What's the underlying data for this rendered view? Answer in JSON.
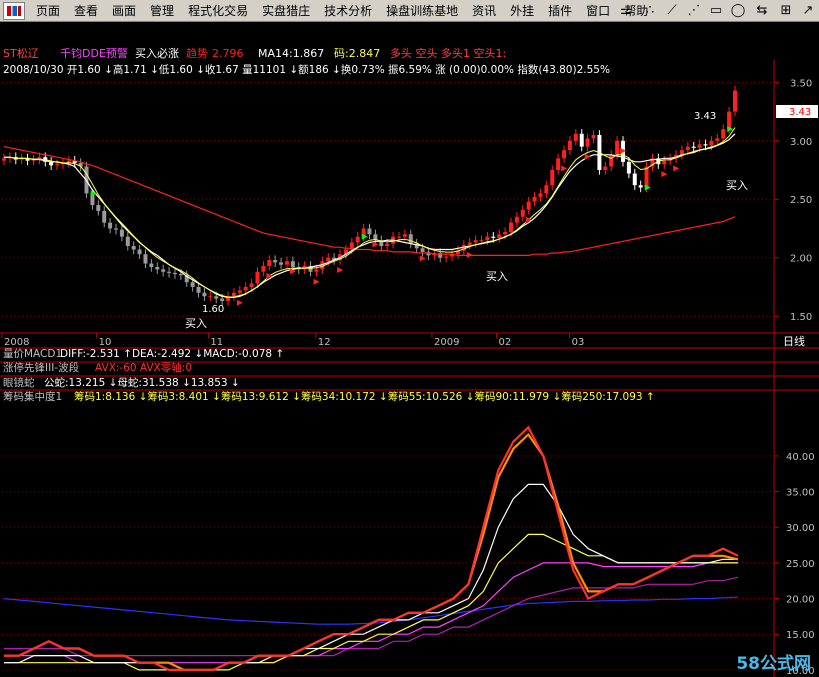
{
  "menubar": {
    "items": [
      "页面",
      "查看",
      "画面",
      "管理",
      "程式化交易",
      "实盘猎庄",
      "技术分析",
      "操盘训练基地",
      "资讯",
      "外挂",
      "插件",
      "窗口",
      "帮助"
    ]
  },
  "toolbar": {
    "icons": [
      "chart-dash-icon",
      "dots-icon",
      "line-tool-icon",
      "fan-tool-icon",
      "ray-tool-icon",
      "rectangle-icon",
      "ellipse-icon",
      "arrows-icon",
      "grid-icon"
    ]
  },
  "colors": {
    "background": "#000000",
    "up": "#ff2020",
    "down": "#ffffff",
    "grid": "#7a0000",
    "ma_short": "#ffffff",
    "ma_long": "#ff2020",
    "ma_yellow": "#ffff40",
    "blue": "#2020ff",
    "magenta": "#ff20ff",
    "orange": "#ff6000",
    "buy_green": "#00ff00",
    "axis_text": "#c0c0c0"
  },
  "header": {
    "stock": "ST松辽",
    "indicator": "千钧DDE预警",
    "signal": "买入必涨",
    "trend_label": "趋势",
    "trend_value": "2.796",
    "ma14": "MA14:1.867",
    "code_label": "码:2.847",
    "flags": "多头  空头  多头1  空头1:",
    "line2": "2008/10/30  开1.60 ↓高1.71 ↓低1.60 ↓收1.67  量11101 ↓额186 ↓换0.73%  振6.59%  涨 (0.00)0.00%  指数(43.80)2.55%"
  },
  "panels": {
    "macd_title": "量价MACD1",
    "macd_values": "DIFF:-2.531 ↑DEA:-2.492 ↓MACD:-0.078 ↑",
    "wave_title": "涨停先锋III-波段",
    "wave_values": "AVX:-60  AVX零轴:0",
    "snake_title": "眼镜蛇",
    "snake_values": "公蛇:13.215 ↓母蛇:31.538 ↓13.853 ↓",
    "chip_title": "筹码集中度1",
    "chip_values": "筹码1:8.136 ↓筹码3:8.401 ↓筹码13:9.612 ↓筹码34:10.172 ↓筹码55:10.526 ↓筹码90:11.979 ↓筹码250:17.093 ↑"
  },
  "annotations": {
    "buy": "买入",
    "low_label": "1.60",
    "high_label": "3.43",
    "current_price": "3.43",
    "day_label": "日线",
    "watermark": "58公式网",
    "watermark_url": "www.58gu.com"
  },
  "chart_data": [
    {
      "type": "candlestick",
      "title": "ST松辽 日线",
      "x_labels": [
        "2008",
        "10",
        "11",
        "12",
        "2009",
        "02",
        "03"
      ],
      "y_ticks": [
        1.5,
        2.0,
        2.5,
        3.0,
        3.5
      ],
      "ylim": [
        1.45,
        3.52
      ],
      "close": [
        2.85,
        2.86,
        2.84,
        2.85,
        2.83,
        2.84,
        2.86,
        2.82,
        2.79,
        2.8,
        2.81,
        2.83,
        2.81,
        2.78,
        2.55,
        2.45,
        2.4,
        2.3,
        2.25,
        2.24,
        2.18,
        2.1,
        2.07,
        2.03,
        1.95,
        1.92,
        1.9,
        1.88,
        1.87,
        1.86,
        1.85,
        1.79,
        1.75,
        1.7,
        1.67,
        1.67,
        1.65,
        1.63,
        1.67,
        1.7,
        1.72,
        1.75,
        1.78,
        1.88,
        1.93,
        1.98,
        1.96,
        1.94,
        1.97,
        1.92,
        1.9,
        1.93,
        1.88,
        1.9,
        1.97,
        2.0,
        1.98,
        2.03,
        2.07,
        2.13,
        2.18,
        2.25,
        2.2,
        2.15,
        2.1,
        2.12,
        2.18,
        2.18,
        2.2,
        2.12,
        2.08,
        2.05,
        2.02,
        2.04,
        2.0,
        2.01,
        2.03,
        2.06,
        2.11,
        2.13,
        2.15,
        2.15,
        2.18,
        2.17,
        2.2,
        2.22,
        2.3,
        2.35,
        2.41,
        2.48,
        2.52,
        2.55,
        2.62,
        2.75,
        2.85,
        2.92,
        3.0,
        3.06,
        2.95,
        3.02,
        3.05,
        2.75,
        2.78,
        2.88,
        3.0,
        2.82,
        2.72,
        2.62,
        2.6,
        2.78,
        2.85,
        2.8,
        2.83,
        2.85,
        2.88,
        2.92,
        2.95,
        2.94,
        2.97,
        2.96,
        3.0,
        3.02,
        3.1,
        3.25,
        3.43
      ],
      "ma_white": [
        2.86,
        2.86,
        2.85,
        2.85,
        2.85,
        2.84,
        2.84,
        2.83,
        2.82,
        2.82,
        2.81,
        2.8,
        2.78,
        2.72,
        2.66,
        2.58,
        2.52,
        2.46,
        2.4,
        2.34,
        2.28,
        2.23,
        2.18,
        2.13,
        2.09,
        2.05,
        2.02,
        1.98,
        1.94,
        1.91,
        1.88,
        1.84,
        1.81,
        1.78,
        1.75,
        1.72,
        1.69,
        1.67,
        1.66,
        1.66,
        1.67,
        1.69,
        1.72,
        1.75,
        1.79,
        1.82,
        1.85,
        1.87,
        1.89,
        1.9,
        1.91,
        1.91,
        1.92,
        1.93,
        1.94,
        1.96,
        1.98,
        2.0,
        2.03,
        2.06,
        2.09,
        2.11,
        2.13,
        2.14,
        2.14,
        2.15,
        2.15,
        2.14,
        2.13,
        2.12,
        2.11,
        2.1,
        2.08,
        2.07,
        2.07,
        2.07,
        2.07,
        2.08,
        2.09,
        2.1,
        2.11,
        2.12,
        2.13,
        2.14,
        2.16,
        2.18,
        2.2,
        2.23,
        2.27,
        2.3,
        2.34,
        2.39,
        2.45,
        2.52,
        2.6,
        2.67,
        2.74,
        2.79,
        2.83,
        2.86,
        2.88,
        2.88,
        2.88,
        2.88,
        2.87,
        2.86,
        2.84,
        2.82,
        2.82,
        2.83,
        2.84,
        2.84,
        2.85,
        2.85,
        2.86,
        2.88,
        2.89,
        2.9,
        2.92,
        2.93,
        2.94,
        2.96,
        2.98,
        3.01,
        3.06
      ],
      "ma_red": [
        2.95,
        2.94,
        2.93,
        2.92,
        2.91,
        2.9,
        2.89,
        2.88,
        2.87,
        2.86,
        2.85,
        2.84,
        2.83,
        2.82,
        2.8,
        2.79,
        2.77,
        2.75,
        2.73,
        2.71,
        2.69,
        2.67,
        2.65,
        2.63,
        2.61,
        2.59,
        2.57,
        2.55,
        2.53,
        2.51,
        2.49,
        2.47,
        2.45,
        2.43,
        2.41,
        2.39,
        2.37,
        2.35,
        2.33,
        2.31,
        2.29,
        2.27,
        2.25,
        2.23,
        2.21,
        2.2,
        2.19,
        2.18,
        2.17,
        2.16,
        2.15,
        2.14,
        2.13,
        2.12,
        2.11,
        2.1,
        2.09,
        2.09,
        2.08,
        2.08,
        2.07,
        2.07,
        2.07,
        2.06,
        2.06,
        2.06,
        2.05,
        2.05,
        2.05,
        2.05,
        2.04,
        2.04,
        2.04,
        2.03,
        2.03,
        2.03,
        2.03,
        2.02,
        2.02,
        2.02,
        2.02,
        2.02,
        2.02,
        2.02,
        2.02,
        2.02,
        2.02,
        2.02,
        2.02,
        2.02,
        2.03,
        2.03,
        2.03,
        2.04,
        2.04,
        2.05,
        2.05,
        2.06,
        2.07,
        2.08,
        2.09,
        2.1,
        2.11,
        2.12,
        2.13,
        2.14,
        2.15,
        2.16,
        2.17,
        2.18,
        2.19,
        2.2,
        2.21,
        2.22,
        2.23,
        2.24,
        2.25,
        2.26,
        2.27,
        2.28,
        2.29,
        2.3,
        2.31,
        2.33,
        2.35
      ]
    },
    {
      "type": "line",
      "title": "筹码集中度1",
      "y_ticks": [
        10,
        15,
        20,
        25,
        30,
        35,
        40
      ],
      "ylim": [
        9,
        47
      ],
      "series": [
        {
          "name": "筹码1",
          "color": "#ff3030",
          "values": [
            12,
            12,
            13,
            14,
            13,
            13,
            12,
            12,
            12,
            11,
            11,
            10,
            10,
            10,
            10,
            11,
            11,
            12,
            12,
            12,
            13,
            14,
            15,
            15,
            16,
            17,
            17,
            18,
            18,
            19,
            20,
            22,
            30,
            38,
            42,
            44,
            40,
            32,
            24,
            20,
            21,
            22,
            22,
            23,
            24,
            25,
            26,
            26,
            27,
            26
          ]
        },
        {
          "name": "筹码3",
          "color": "#ff9000",
          "values": [
            12,
            12,
            13,
            14,
            13,
            13,
            12,
            12,
            12,
            11,
            11,
            11,
            10,
            10,
            10,
            11,
            11,
            12,
            12,
            12,
            13,
            14,
            15,
            15,
            16,
            17,
            17,
            18,
            18,
            19,
            20,
            22,
            29,
            37,
            41,
            43,
            40,
            33,
            25,
            21,
            21,
            22,
            22,
            23,
            24,
            25,
            26,
            26,
            26,
            25.5
          ]
        },
        {
          "name": "筹码13",
          "color": "#ffffff",
          "values": [
            11,
            11,
            12,
            12,
            12,
            12,
            11,
            11,
            11,
            11,
            11,
            10,
            10,
            10,
            10,
            11,
            11,
            11,
            12,
            12,
            13,
            13,
            14,
            15,
            15,
            16,
            17,
            17,
            18,
            18,
            19,
            20,
            24,
            30,
            34,
            36,
            36,
            33,
            29,
            27,
            26,
            25,
            25,
            25,
            25,
            25,
            25,
            25,
            25.5,
            25.5
          ]
        },
        {
          "name": "筹码34",
          "color": "#ffff40",
          "values": [
            11,
            11,
            11,
            11,
            11,
            11,
            11,
            11,
            11,
            10,
            10,
            10,
            10,
            10,
            10,
            10,
            11,
            11,
            11,
            12,
            12,
            13,
            13,
            14,
            14,
            15,
            15,
            16,
            17,
            17,
            18,
            19,
            21,
            25,
            27,
            29,
            29,
            28,
            27,
            26,
            26,
            25,
            25,
            25,
            25,
            25,
            25,
            25,
            25,
            25
          ]
        },
        {
          "name": "筹码55",
          "color": "#ff40ff",
          "values": [
            12,
            12,
            12,
            12,
            12,
            11,
            11,
            11,
            11,
            11,
            11,
            11,
            11,
            11,
            11,
            11,
            11,
            11,
            11,
            12,
            12,
            12,
            13,
            13,
            14,
            14,
            15,
            15,
            16,
            16,
            17,
            18,
            19,
            21,
            23,
            24,
            25,
            25,
            25,
            25,
            24.5,
            24.5,
            24.5,
            24.5,
            24.5,
            24.5,
            24.5,
            25,
            25,
            25
          ]
        },
        {
          "name": "筹码90",
          "color": "#b020b0",
          "values": [
            13,
            13,
            13,
            13,
            13,
            12,
            12,
            12,
            12,
            12,
            12,
            12,
            12,
            12,
            12,
            12,
            12,
            12,
            12,
            12,
            12,
            12,
            12,
            13,
            13,
            13,
            14,
            14,
            15,
            15,
            16,
            16,
            17,
            18,
            19,
            20,
            20.5,
            21,
            21.5,
            21.5,
            21.5,
            21.5,
            21.5,
            22,
            22,
            22,
            22,
            22.5,
            22.5,
            23
          ]
        },
        {
          "name": "筹码250",
          "color": "#3030ff",
          "values": [
            20,
            19.8,
            19.6,
            19.4,
            19.2,
            19,
            18.8,
            18.6,
            18.4,
            18.2,
            18,
            17.8,
            17.6,
            17.4,
            17.2,
            17,
            16.9,
            16.8,
            16.7,
            16.6,
            16.5,
            16.4,
            16.4,
            16.4,
            16.5,
            16.6,
            16.8,
            17,
            17.3,
            17.6,
            17.9,
            18.2,
            18.5,
            18.8,
            19.1,
            19.3,
            19.4,
            19.5,
            19.6,
            19.6,
            19.7,
            19.7,
            19.8,
            19.8,
            19.9,
            19.9,
            20,
            20,
            20.1,
            20.2
          ]
        }
      ]
    }
  ]
}
